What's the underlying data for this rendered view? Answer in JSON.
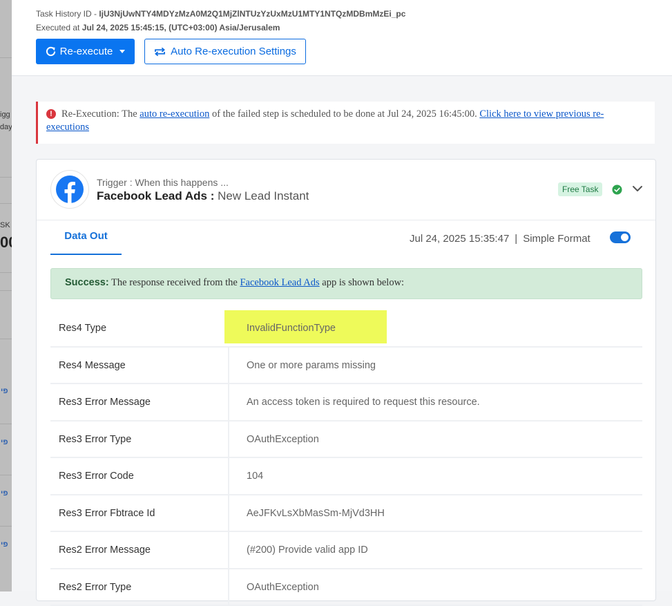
{
  "header": {
    "task_history_label": "Task History ID - ",
    "task_history_id": "IjU3NjUwNTY4MDYzMzA0M2Q1MjZlNTUzYzUxMzU1MTY1NTQzMDBmMzEi_pc",
    "executed_label": "Executed at ",
    "executed_at": "Jul 24, 2025 15:45:15, (UTC+03:00) Asia/Jerusalem",
    "reexecute_label": "Re-execute",
    "auto_settings_label": "Auto Re-execution Settings"
  },
  "alert": {
    "prefix": "Re-Execution: The ",
    "link1": "auto re-execution",
    "middle": " of the failed step is scheduled to be done at Jul 24, 2025 16:45:00. ",
    "link2": "Click here to view previous re-executions"
  },
  "trigger": {
    "label": "Trigger : When this happens ...",
    "app": "Facebook Lead Ads :",
    "event": "New Lead Instant",
    "badge": "Free Task"
  },
  "tabs": {
    "data_out": "Data Out",
    "timestamp": "Jul 24, 2025 15:35:47",
    "separator": "|",
    "simple_format": "Simple Format"
  },
  "success": {
    "label": "Success:",
    "text1": " The response received from the ",
    "link": "Facebook Lead Ads",
    "text2": " app is shown below:"
  },
  "rows": [
    {
      "key": "Res4 Type",
      "value": "InvalidFunctionType"
    },
    {
      "key": "Res4 Message",
      "value": "One or more params missing"
    },
    {
      "key": "Res3 Error Message",
      "value": "An access token is required to request this resource."
    },
    {
      "key": "Res3 Error Type",
      "value": "OAuthException"
    },
    {
      "key": "Res3 Error Code",
      "value": "104"
    },
    {
      "key": "Res3 Error Fbtrace Id",
      "value": "AeJFKvLsXbMasSm-MjVd3HH"
    },
    {
      "key": "Res2 Error Message",
      "value": "(#200) Provide valid app ID"
    },
    {
      "key": "Res2 Error Type",
      "value": "OAuthException"
    }
  ],
  "backdrop": {
    "t1": "igg",
    "t2": "day",
    "t3": "SK",
    "t4": "00",
    "t5": "פי"
  },
  "colors": {
    "primary": "#0a75f0",
    "error": "#d9363e",
    "success_bg": "#d3ebd9",
    "highlight": "#eefa5a"
  }
}
